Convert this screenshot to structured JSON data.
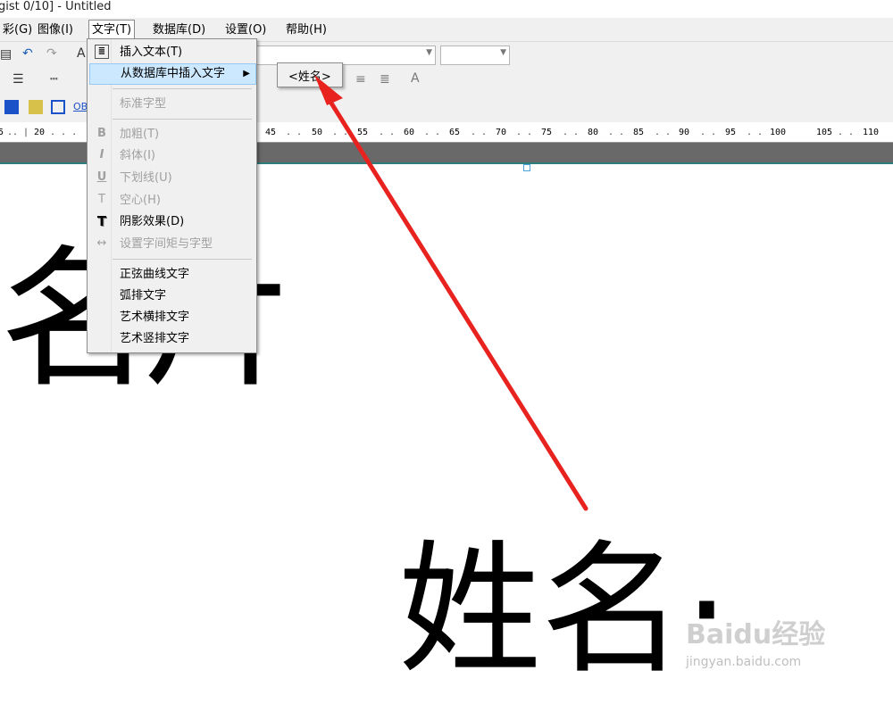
{
  "window": {
    "title": "gist 0/10] - Untitled"
  },
  "menubar": {
    "items": [
      {
        "label": "彩(G)"
      },
      {
        "label": "图像(I)"
      },
      {
        "label": "文字(T)"
      },
      {
        "label": "数据库(D)"
      },
      {
        "label": "设置(O)"
      },
      {
        "label": "帮助(H)"
      }
    ]
  },
  "text_menu": {
    "insert_text": "插入文本(T)",
    "insert_from_db": "从数据库中插入文字",
    "standard_font": "标准字型",
    "bold": "加粗(T)",
    "italic": "斜体(I)",
    "underline": "下划线(U)",
    "hollow": "空心(H)",
    "shadow": "阴影效果(D)",
    "spacing": "设置字间矩与字型",
    "sine": "正弦曲线文字",
    "arc": "弧排文字",
    "art_h": "艺术横排文字",
    "art_v": "艺术竖排文字"
  },
  "submenu": {
    "field": "<姓名>"
  },
  "ruler": {
    "ticks": [
      "5",
      "20",
      "45",
      "50",
      "55",
      "60",
      "65",
      "70",
      "75",
      "80",
      "85",
      "90",
      "95",
      "100",
      "105",
      "110"
    ]
  },
  "canvas": {
    "text_top": "名片",
    "text_main": "姓名·"
  },
  "watermark": {
    "brand": "Baidu经验",
    "url": "jingyan.baidu.com"
  },
  "colors": {
    "highlight": "#cce8ff",
    "arrow": "#e8231f",
    "menubg": "#f0f0f0"
  }
}
